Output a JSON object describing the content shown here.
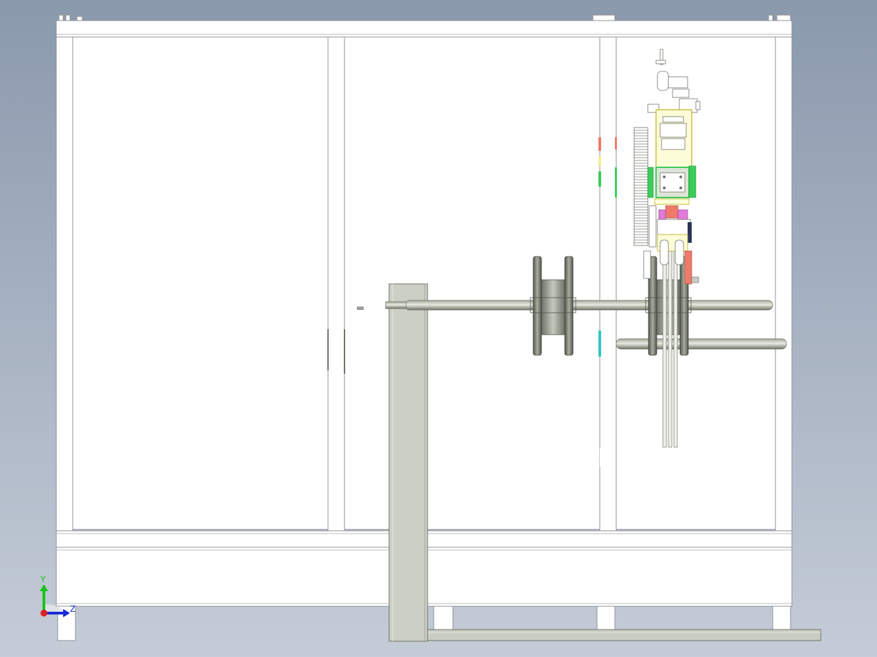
{
  "viewport": {
    "background_top": "#8b99ad",
    "background_bottom": "#c4ccd7"
  },
  "triad": {
    "y_label": "Y",
    "z_label": "Z",
    "y_color": "#18c418",
    "z_color": "#1a2ad8",
    "x_color": "#e02020"
  },
  "colors": {
    "frame_fill": "#ffffff",
    "frame_stroke": "#8c9096",
    "steel": "#c9cdc4",
    "steel_dark": "#6f7366",
    "accent_yellow": "#f2ee90",
    "accent_green": "#3ccc5a",
    "accent_pink": "#e27ad8",
    "accent_salmon": "#f07a6a",
    "accent_cyan": "#32c8c0"
  }
}
